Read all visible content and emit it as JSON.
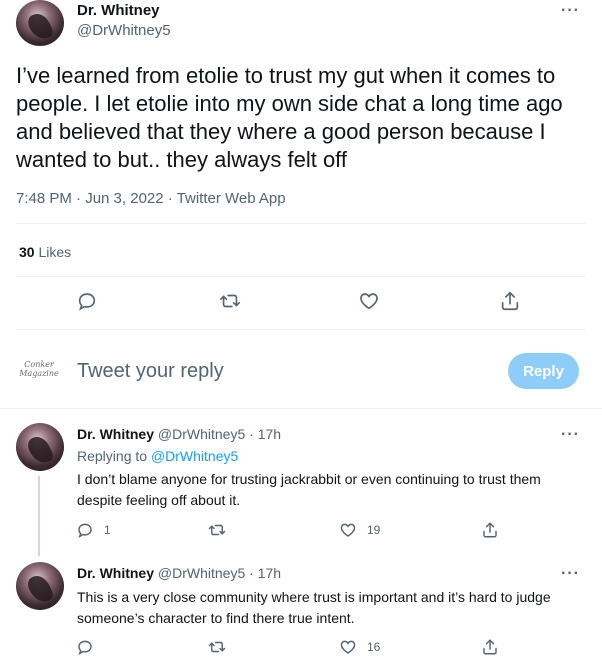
{
  "main_tweet": {
    "name": "Dr. Whitney",
    "handle": "@DrWhitney5",
    "more": "···",
    "text": "I’ve learned from etolie to trust my gut when it comes to people. I let etolie into my own side chat a long time ago and believed that they where a good person because I wanted to but.. they always felt off",
    "meta": "7:48 PM · Jun 3, 2022 · Twitter Web App",
    "likes_count": "30",
    "likes_label": "Likes"
  },
  "compose": {
    "avatar_text": "Conker Magazine",
    "placeholder": "Tweet your reply",
    "reply_label": "Reply"
  },
  "replies": [
    {
      "name": "Dr. Whitney",
      "handle": "@DrWhitney5",
      "time": "· 17h",
      "replying_prefix": "Replying to",
      "replying_handle": "@DrWhitney5",
      "text": "I don’t blame anyone for trusting jackrabbit or even continuing to trust them despite feeling off about it.",
      "reply_count": "1",
      "retweet_count": "",
      "like_count": "19",
      "more": "···"
    },
    {
      "name": "Dr. Whitney",
      "handle": "@DrWhitney5",
      "time": "· 17h",
      "text": "This is a very close community where trust is important and it’s hard to judge someone’s character to find there true intent.",
      "reply_count": "",
      "retweet_count": "",
      "like_count": "16",
      "more": "···"
    }
  ],
  "icons": {
    "reply": "speech-bubble-icon",
    "retweet": "retweet-icon",
    "like": "heart-icon",
    "share": "share-icon",
    "more": "more-horizontal-icon"
  },
  "colors": {
    "accent": "#1d9bf0",
    "reply_button_disabled": "#8ecdf7",
    "muted": "#536471",
    "divider": "#eff3f4"
  }
}
